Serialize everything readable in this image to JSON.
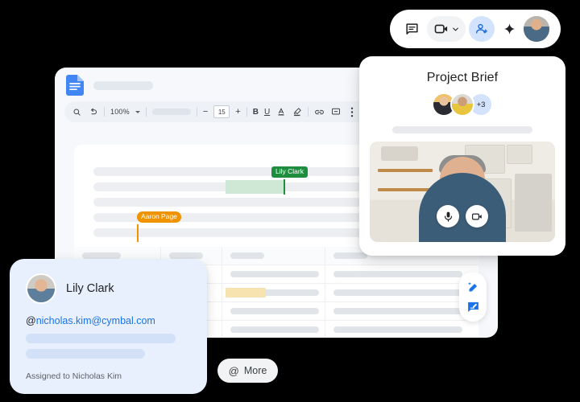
{
  "meet_toolbar": {
    "chat_icon": "chat-bubble-icon",
    "camera_icon": "video-camera-icon",
    "camera_caret_icon": "chevron-down-icon",
    "people_icon": "add-people-icon",
    "sparkle_icon": "gemini-sparkle-icon",
    "avatar_label": "self-avatar"
  },
  "docs": {
    "app_icon": "google-docs-icon",
    "title_placeholder": "",
    "toolbar": {
      "search_icon": "search-icon",
      "undo_icon": "undo-icon",
      "zoom_value": "100%",
      "zoom_caret_icon": "chevron-down-icon",
      "font_placeholder": "",
      "font_size_minus": "−",
      "font_size_value": "15",
      "font_size_plus": "+",
      "bold_label": "B",
      "underline_label": "U",
      "text_color_icon": "text-color-icon",
      "highlight_icon": "highlighter-icon",
      "link_icon": "insert-link-icon",
      "comment_icon": "add-comment-icon",
      "more_icon": "more-options-icon"
    },
    "collaborators": [
      {
        "name": "Lily Clark",
        "color": "#1e8e3e"
      },
      {
        "name": "Aaron Page",
        "color": "#f09300"
      }
    ],
    "table": {
      "header_cells": [
        "",
        "",
        "",
        ""
      ],
      "rows": [
        [
          "",
          "",
          "",
          ""
        ],
        [
          "",
          "",
          "",
          ""
        ],
        [
          "",
          "",
          "",
          ""
        ],
        [
          "",
          "",
          "",
          ""
        ]
      ],
      "highlight_color": "#f6e3b0"
    },
    "ai_tools": {
      "write_icon": "ai-magic-pen-icon",
      "comment_icon": "comment-edit-icon"
    }
  },
  "brief_card": {
    "title": "Project Brief",
    "avatar_overflow": "+3",
    "participants": [
      "participant-1",
      "participant-2"
    ],
    "video_controls": {
      "mic_icon": "microphone-icon",
      "camera_icon": "video-camera-icon"
    }
  },
  "comment_card": {
    "author": "Lily Clark",
    "avatar_label": "lily-clark-avatar",
    "mention_prefix": "@",
    "mention_email": "nicholas.kim@cymbal.com",
    "assigned_text": "Assigned to Nicholas Kim",
    "accent_color": "#1a73e8"
  },
  "more_chip": {
    "icon": "at-mention-icon",
    "label": "More"
  }
}
